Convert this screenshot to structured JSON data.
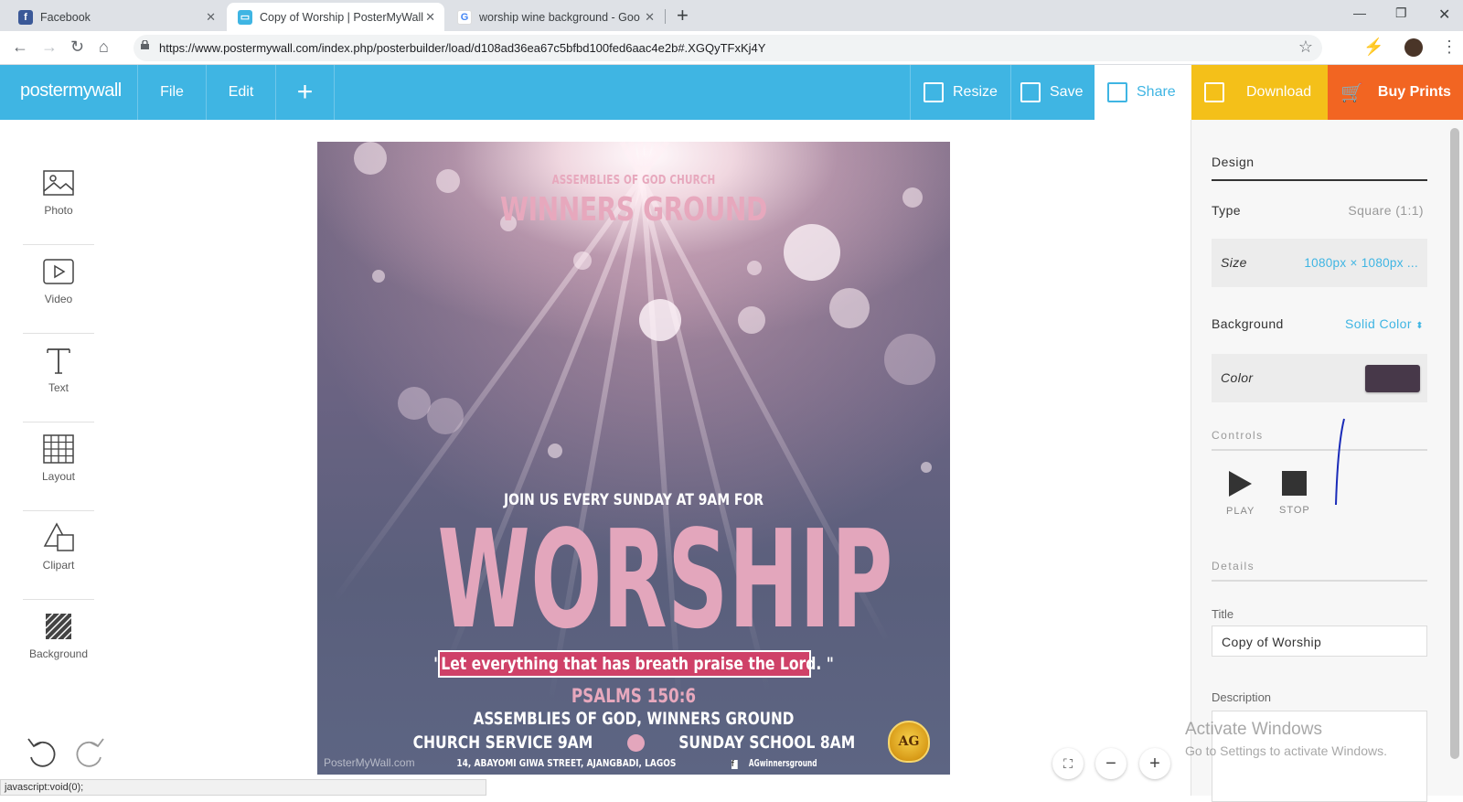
{
  "browser": {
    "tabs": [
      {
        "title": "Facebook",
        "favicon": "facebook-icon",
        "active": false
      },
      {
        "title": "Copy of Worship | PosterMyWall",
        "favicon": "postermywall-icon",
        "active": true
      },
      {
        "title": "worship wine background - Goo",
        "favicon": "google-icon",
        "active": false
      }
    ],
    "url": "https://www.postermywall.com/index.php/posterbuilder/load/d108ad36ea67c5bfbd100fed6aac4e2b#.XGQyTFxKj4Y"
  },
  "app": {
    "logo": "postermywall",
    "menu": {
      "file": "File",
      "edit": "Edit",
      "add": "+"
    },
    "actions": {
      "resize": "Resize",
      "save": "Save",
      "share": "Share",
      "download": "Download",
      "buy_prints": "Buy Prints"
    },
    "colors": {
      "nav": "#3fb5e3",
      "download": "#f4c019",
      "buy_prints": "#f26522"
    }
  },
  "tools": [
    {
      "label": "Photo",
      "icon": "photo-icon"
    },
    {
      "label": "Video",
      "icon": "video-icon"
    },
    {
      "label": "Text",
      "icon": "text-icon"
    },
    {
      "label": "Layout",
      "icon": "layout-icon"
    },
    {
      "label": "Clipart",
      "icon": "clipart-icon"
    },
    {
      "label": "Background",
      "icon": "background-icon"
    }
  ],
  "poster": {
    "church": "ASSEMBLIES OF GOD CHURCH",
    "name": "WINNERS GROUND",
    "join": "JOIN US EVERY SUNDAY AT 9AM FOR",
    "headline": "WORSHIP",
    "quote": "\"Let everything that has breath praise the Lord. \"",
    "verse": "PSALMS 150:6",
    "org": "ASSEMBLIES OF GOD, WINNERS GROUND",
    "service": "CHURCH SERVICE 9AM",
    "school": "SUNDAY SCHOOL 8AM",
    "address": "14, ABAYOMI GIWA STREET, AJANGBADI, LAGOS",
    "facebook": "AGwinnersground",
    "watermark": "PosterMyWall.com",
    "logo_text": "AG"
  },
  "panel": {
    "tab": "Design",
    "type_label": "Type",
    "type_value": "Square (1:1)",
    "size_label": "Size",
    "size_value": "1080px × 1080px ...",
    "background_label": "Background",
    "background_value": "Solid Color",
    "color_label": "Color",
    "color_value": "#473849",
    "controls_label": "Controls",
    "play": "PLAY",
    "stop": "STOP",
    "details_label": "Details",
    "title_label": "Title",
    "title_value": "Copy of Worship",
    "description_label": "Description"
  },
  "windows": {
    "line1": "Activate Windows",
    "line2": "Go to Settings to activate Windows."
  },
  "status": "javascript:void(0);"
}
